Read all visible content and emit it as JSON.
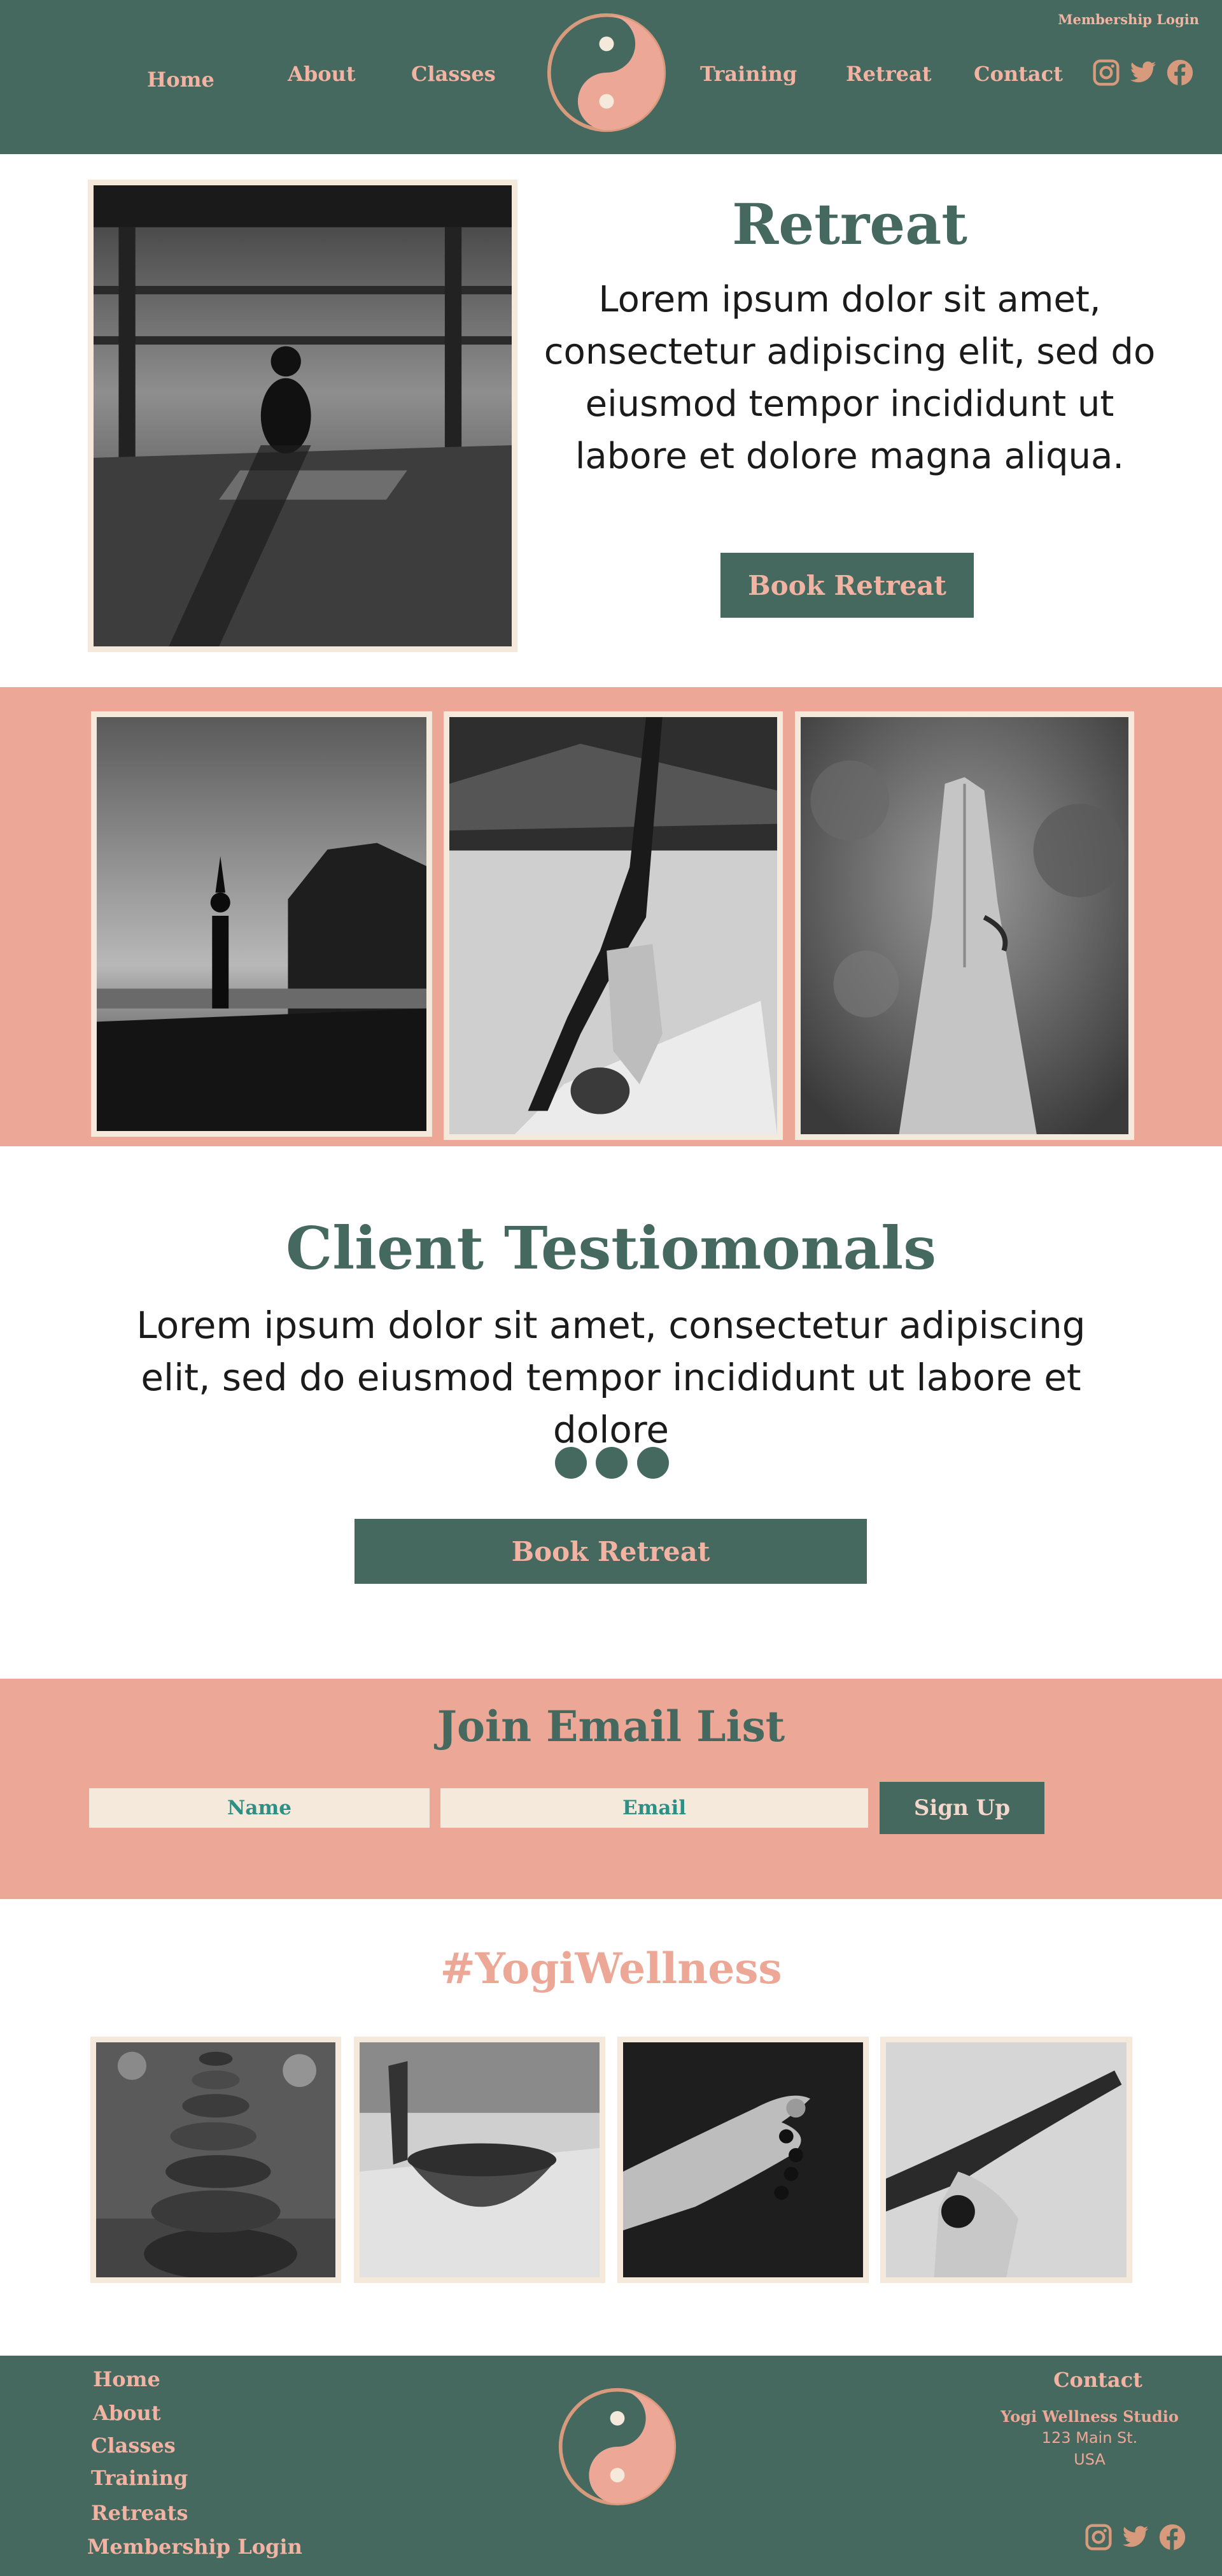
{
  "header": {
    "member_login": "Membership Login",
    "nav": [
      "Home",
      "About",
      "Classes",
      "Training",
      "Retreat",
      "Contact"
    ],
    "social_icons": [
      "instagram-icon",
      "twitter-icon",
      "facebook-icon"
    ],
    "logo_icon": "yin-yang-icon"
  },
  "retreat": {
    "title": "Retreat",
    "text": "Lorem ipsum dolor sit amet, consectetur adipiscing elit, sed do eiusmod tempor incididunt ut labore et dolore magna aliqua.",
    "button": "Book Retreat"
  },
  "testimonials": {
    "title": "Client Testiomonals",
    "text": "Lorem ipsum dolor sit amet, consectetur adipiscing elit, sed do eiusmod tempor incididunt ut labore et dolore",
    "button": "Book Retreat",
    "dots": 3
  },
  "email": {
    "title": "Join Email List",
    "name_placeholder": "Name",
    "email_placeholder": "Email",
    "button": "Sign Up"
  },
  "hashtag": "#YogiWellness",
  "footer": {
    "links": [
      "Home",
      "About",
      "Classes",
      "Training",
      "Retreats",
      "Membership Login"
    ],
    "contact_title": "Contact",
    "studio": "Yogi Wellness Studio",
    "street": "123 Main St.",
    "country": "USA"
  },
  "colors": {
    "green": "#45685f",
    "pink": "#eca796",
    "cream": "#f4e9da",
    "teal_text": "#2d8f86"
  }
}
